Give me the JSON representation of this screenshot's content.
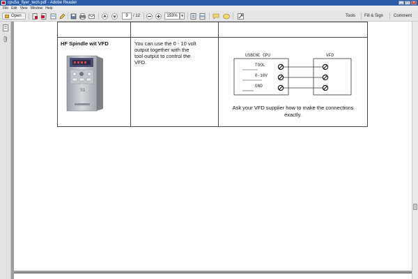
{
  "window": {
    "title": "cpu5a_flyer_tech.pdf - Adobe Reader"
  },
  "menu": [
    "File",
    "Edit",
    "View",
    "Window",
    "Help"
  ],
  "toolbar": {
    "open_label": "Open",
    "page_current": "9",
    "page_total": "/ 12",
    "zoom": "153%",
    "tools_label": "Tools",
    "fill_sign_label": "Fill & Sign",
    "comment_label": "Comment"
  },
  "document": {
    "row": {
      "title": "HF Spindle wit VFD",
      "description_lines": [
        "You can use the 0 - 10 volt",
        "output together with the",
        "tool output to control the",
        "VFD."
      ],
      "diagram": {
        "left_block": "USBCNC CPU",
        "right_block": "VFD",
        "signals": [
          "TOOL",
          "0-10V",
          "GND"
        ],
        "drive_label": "S1"
      },
      "caption_lines": [
        "Ask your VFD supplier how to make the connections",
        "exactly."
      ]
    }
  }
}
